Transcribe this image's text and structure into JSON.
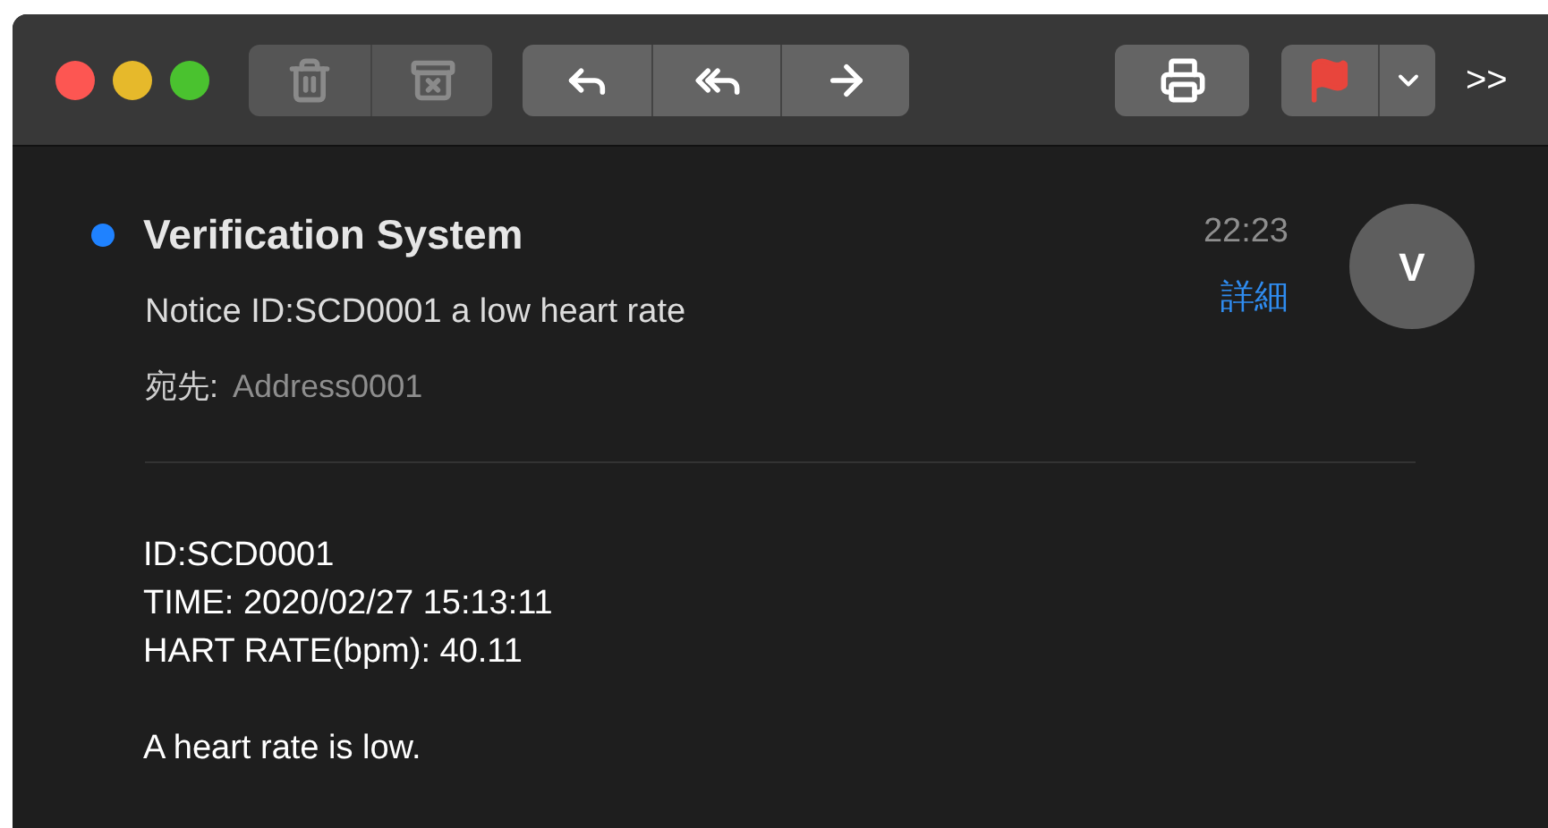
{
  "toolbar": {
    "groups": [
      {
        "buttons": [
          {
            "kind": "trash",
            "disabled": true
          },
          {
            "kind": "trash-x",
            "disabled": true
          }
        ]
      },
      {
        "buttons": [
          {
            "kind": "reply",
            "disabled": false
          },
          {
            "kind": "reply-all",
            "disabled": false
          },
          {
            "kind": "forward",
            "disabled": false
          }
        ]
      },
      {
        "buttons": [
          {
            "kind": "print",
            "disabled": false
          }
        ]
      },
      {
        "buttons": [
          {
            "kind": "flag",
            "disabled": false
          },
          {
            "kind": "chevron",
            "disabled": false
          }
        ]
      }
    ],
    "overflow": ">>"
  },
  "message": {
    "unread": true,
    "sender": "Verification System",
    "time": "22:23",
    "details_link": "詳細",
    "avatar_initial": "V",
    "subject": "Notice ID:SCD0001 a low heart rate",
    "to_label": "宛先:",
    "to": "Address0001",
    "body_paragraphs": [
      [
        "ID:SCD0001",
        "TIME: 2020/02/27 15:13:11",
        "HART RATE(bpm): 40.11"
      ],
      [
        "A heart rate is low."
      ]
    ]
  }
}
